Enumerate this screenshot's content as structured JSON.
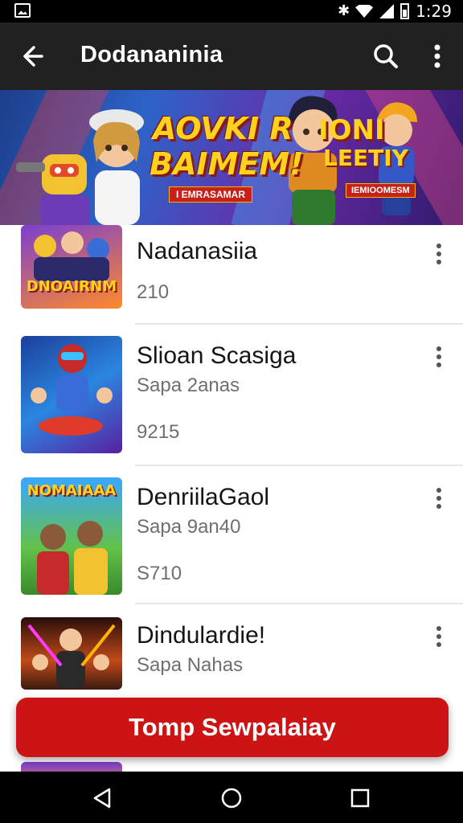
{
  "status_bar": {
    "time": "1:29",
    "icons": [
      "image-icon",
      "bluetooth-icon",
      "wifi-icon",
      "signal-icon",
      "battery-icon"
    ]
  },
  "app_bar": {
    "title": "Dodananinia",
    "icons": [
      "back-arrow-icon",
      "search-icon",
      "more-vert-icon"
    ]
  },
  "banner": {
    "title_line1": "AOVKI R",
    "title_line2": "BAIMEM!",
    "subtitle": "I EMRASAMAR",
    "title_right_line1": "IONI",
    "title_right_line2": "LEETIY",
    "subtitle_right": "IEMIOOMESM"
  },
  "list": {
    "items": [
      {
        "title": "Nadanasiia",
        "subtitle": "",
        "price": "210",
        "thumb_text": "DNOAIRNM"
      },
      {
        "title": "Slioan Scasiga",
        "subtitle": "Sapa 2anas",
        "price": "9215",
        "thumb_text": ""
      },
      {
        "title": "DenriilaGaol",
        "subtitle": "Sapa 9an40",
        "price": "S710",
        "thumb_text": "NOMAIAAA"
      },
      {
        "title": "Dindulardie!",
        "subtitle": "Sapa Nahas",
        "price": "",
        "thumb_text": ""
      }
    ]
  },
  "cta": {
    "label": "Tomp Sewpalaiay"
  },
  "colors": {
    "app_bar_bg": "#212121",
    "accent_red": "#cc1414",
    "banner_yellow": "#ffd21e"
  },
  "nav_bar": {
    "icons": [
      "nav-back-icon",
      "nav-home-icon",
      "nav-recent-icon"
    ]
  }
}
